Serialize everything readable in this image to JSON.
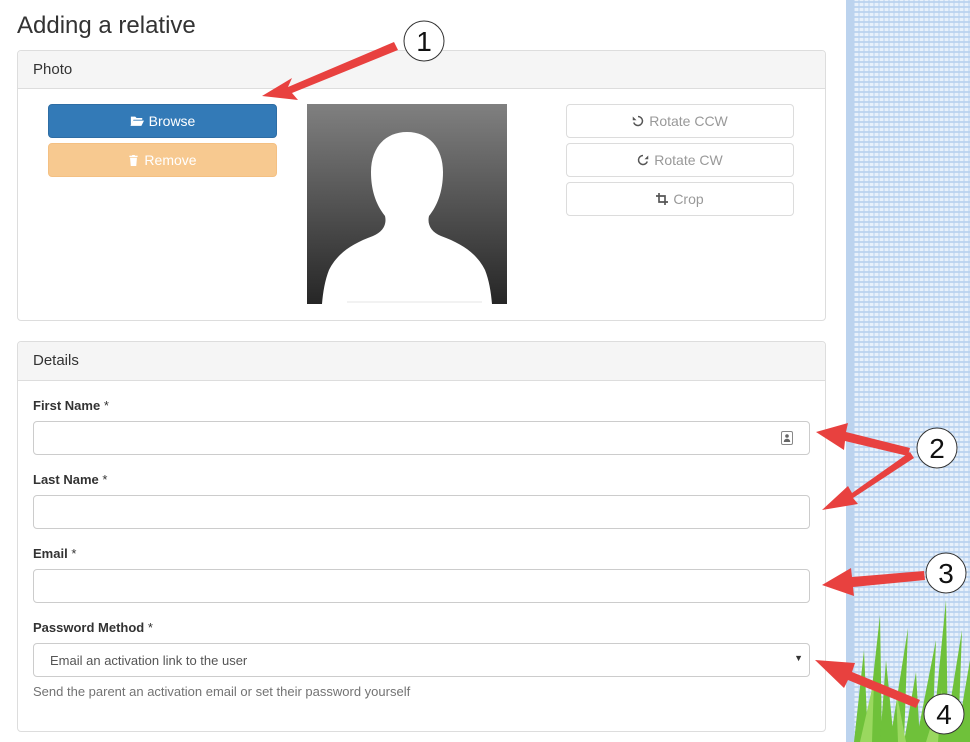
{
  "page": {
    "title": "Adding a relative"
  },
  "photo_panel": {
    "heading": "Photo",
    "browse_label": "Browse",
    "remove_label": "Remove",
    "rotate_ccw_label": "Rotate CCW",
    "rotate_cw_label": "Rotate CW",
    "crop_label": "Crop"
  },
  "details_panel": {
    "heading": "Details",
    "first_name": {
      "label": "First Name",
      "required": "*",
      "value": ""
    },
    "last_name": {
      "label": "Last Name",
      "required": "*",
      "value": ""
    },
    "email": {
      "label": "Email",
      "required": "*",
      "value": ""
    },
    "password_method": {
      "label": "Password Method",
      "required": "*",
      "selected": "Email an activation link to the user",
      "help": "Send the parent an activation email or set their password yourself"
    }
  },
  "callouts": [
    "1",
    "2",
    "3",
    "4"
  ],
  "colors": {
    "primary": "#337ab7",
    "warning": "#f7c990",
    "arrow": "#e8413f",
    "panel_heading": "#f5f5f5"
  },
  "icons": [
    "folder-open-icon",
    "trash-icon",
    "rotate-ccw-icon",
    "rotate-cw-icon",
    "crop-icon",
    "contact-card-icon",
    "caret-down-icon"
  ]
}
